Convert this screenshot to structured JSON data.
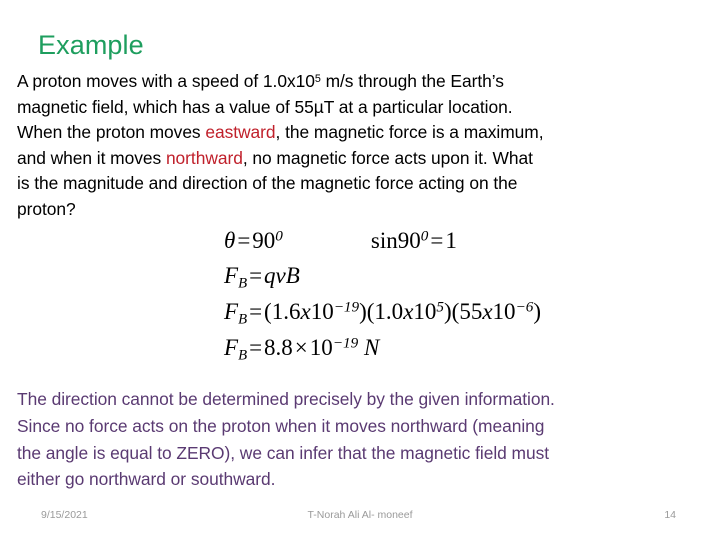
{
  "slide": {
    "title": "Example",
    "title_color": "#1E9E5E",
    "background": "#ffffff"
  },
  "prompt": {
    "text_color": "#000000",
    "highlight_color": "#C0202B",
    "lines": [
      [
        {
          "t": "A proton moves with a speed of 1.0x10",
          "s": "plain"
        },
        {
          "t": "5",
          "s": "sup"
        },
        {
          "t": " m/s through the Earth’s",
          "s": "plain"
        }
      ],
      [
        {
          "t": "magnetic field, which has a value of 55µT at a particular location.",
          "s": "plain"
        }
      ],
      [
        {
          "t": "When the proton moves ",
          "s": "plain"
        },
        {
          "t": "eastward",
          "s": "highlight"
        },
        {
          "t": ", the magnetic force is a maximum,",
          "s": "plain"
        }
      ],
      [
        {
          "t": "and when it moves ",
          "s": "plain"
        },
        {
          "t": "northward",
          "s": "highlight"
        },
        {
          "t": ", no magnetic force acts upon it. What",
          "s": "plain"
        }
      ],
      [
        {
          "t": "is the magnitude and direction of the magnetic force acting on the",
          "s": "plain"
        }
      ],
      [
        {
          "t": "proton?",
          "s": "plain"
        }
      ]
    ]
  },
  "math": {
    "rows": [
      {
        "id": "angle-and-sine",
        "plain": "θ = 90⁰        sin 90⁰ = 1",
        "parts": [
          {
            "t": "θ",
            "s": "italic"
          },
          {
            "t": "=",
            "s": "op"
          },
          {
            "t": "90",
            "s": "upright"
          },
          {
            "t": "0",
            "s": "sup"
          },
          {
            "t": "",
            "s": "gap"
          },
          {
            "t": "sin",
            "s": "upright"
          },
          {
            "t": "90",
            "s": "upright"
          },
          {
            "t": "0",
            "s": "sup"
          },
          {
            "t": "=",
            "s": "op"
          },
          {
            "t": "1",
            "s": "upright"
          }
        ]
      },
      {
        "id": "force-formula",
        "plain": "F_B = qvB",
        "parts": [
          {
            "t": "F",
            "s": "italic"
          },
          {
            "t": "B",
            "s": "sub"
          },
          {
            "t": "=",
            "s": "op"
          },
          {
            "t": "qvB",
            "s": "italic"
          }
        ]
      },
      {
        "id": "force-substitution",
        "plain": "F_B = (1.6x10^-19)(1.0x10^5)(55x10^-6)",
        "parts": [
          {
            "t": "F",
            "s": "italic"
          },
          {
            "t": "B",
            "s": "sub"
          },
          {
            "t": "=",
            "s": "op"
          },
          {
            "t": "(1.6",
            "s": "upright"
          },
          {
            "t": "x",
            "s": "italic"
          },
          {
            "t": "10",
            "s": "upright"
          },
          {
            "t": "−19",
            "s": "sup"
          },
          {
            "t": ")(1.0",
            "s": "upright"
          },
          {
            "t": "x",
            "s": "italic"
          },
          {
            "t": "10",
            "s": "upright"
          },
          {
            "t": "5",
            "s": "sup"
          },
          {
            "t": ")(55",
            "s": "upright"
          },
          {
            "t": "x",
            "s": "italic"
          },
          {
            "t": "10",
            "s": "upright"
          },
          {
            "t": "−6",
            "s": "sup"
          },
          {
            "t": ")",
            "s": "upright"
          }
        ]
      },
      {
        "id": "force-result",
        "plain": "F_B = 8.8×10^-19 N",
        "parts": [
          {
            "t": "F",
            "s": "italic"
          },
          {
            "t": "B",
            "s": "sub"
          },
          {
            "t": "=",
            "s": "op"
          },
          {
            "t": "8.8",
            "s": "upright"
          },
          {
            "t": "×",
            "s": "op"
          },
          {
            "t": "10",
            "s": "upright"
          },
          {
            "t": "−19",
            "s": "sup"
          },
          {
            "t": " N",
            "s": "italic"
          }
        ]
      }
    ]
  },
  "conclusion": {
    "text_color": "#5A3A72",
    "lines": [
      "The direction cannot be determined precisely by the given information.",
      "Since no force acts on the proton when it moves northward (meaning",
      "the angle is equal to ZERO), we can infer that the magnetic field must",
      "either go northward or southward."
    ]
  },
  "footer": {
    "date": "9/15/2021",
    "author": "T-Norah Ali Al- moneef",
    "page_number": "14",
    "text_color": "#9A9A9A"
  }
}
